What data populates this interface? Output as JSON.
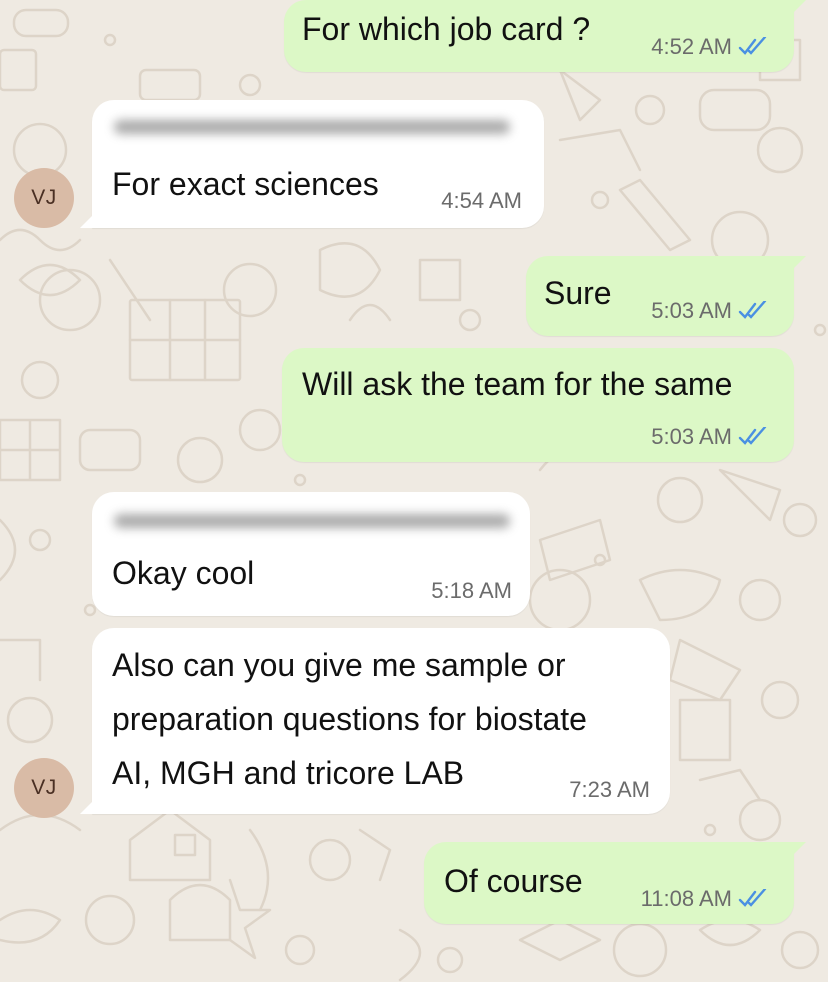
{
  "theme": {
    "wallpaper": "#efeae2",
    "outgoing_bubble": "#dcf8c6",
    "incoming_bubble": "#ffffff",
    "read_tick_color": "#4a90e2"
  },
  "messages": [
    {
      "direction": "outgoing",
      "text": "For which job card ?",
      "time": "4:52 AM",
      "status": "read"
    },
    {
      "direction": "incoming",
      "text": "For exact sciences",
      "time": "4:54 AM",
      "avatar": "VJ",
      "sender_hidden": true
    },
    {
      "direction": "outgoing",
      "text": "Sure",
      "time": "5:03 AM",
      "status": "read"
    },
    {
      "direction": "outgoing",
      "text": "Will ask the team for the same",
      "time": "5:03 AM",
      "status": "read"
    },
    {
      "direction": "incoming",
      "text": "Okay cool",
      "time": "5:18 AM",
      "sender_hidden": true
    },
    {
      "direction": "incoming",
      "lines": [
        "Also can you give me sample or",
        "preparation questions for biostate",
        "AI, MGH and tricore LAB"
      ],
      "time": "7:23 AM",
      "avatar": "VJ"
    },
    {
      "direction": "outgoing",
      "text": "Of course",
      "time": "11:08 AM",
      "status": "read"
    }
  ]
}
